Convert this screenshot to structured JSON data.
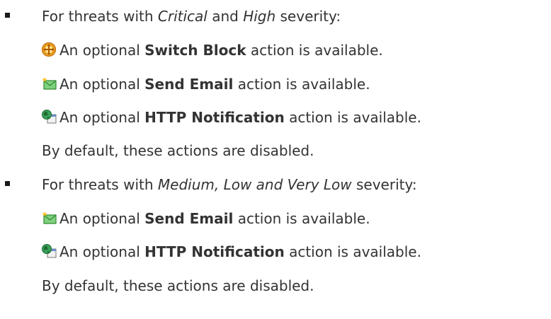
{
  "section1": {
    "intro_prefix": "For threats with ",
    "severity_a": "Critical",
    "and_word": " and ",
    "severity_b": "High",
    "intro_suffix": " severity:",
    "actions": [
      {
        "icon": "switch-block-icon",
        "prefix": "An optional ",
        "name": "Switch Block",
        "suffix": " action is available."
      },
      {
        "icon": "send-email-icon",
        "prefix": "An optional ",
        "name": "Send Email",
        "suffix": " action is available."
      },
      {
        "icon": "http-notification-icon",
        "prefix": "An optional ",
        "name": "HTTP Notification",
        "suffix": " action is available."
      }
    ],
    "note": "By default, these actions are disabled."
  },
  "section2": {
    "intro_prefix": "For threats with ",
    "severity": "Medium, Low and Very Low",
    "intro_suffix": " severity:",
    "actions": [
      {
        "icon": "send-email-icon",
        "prefix": "An optional ",
        "name": "Send Email",
        "suffix": " action is available."
      },
      {
        "icon": "http-notification-icon",
        "prefix": "An optional ",
        "name": "HTTP Notification",
        "suffix": " action is available."
      }
    ],
    "note": "By default, these actions are disabled."
  },
  "colors": {
    "text": "#333333",
    "switch_icon": "#f0a020",
    "email_icon": "#3a9a3a",
    "globe_icon": "#2a7a3a"
  }
}
